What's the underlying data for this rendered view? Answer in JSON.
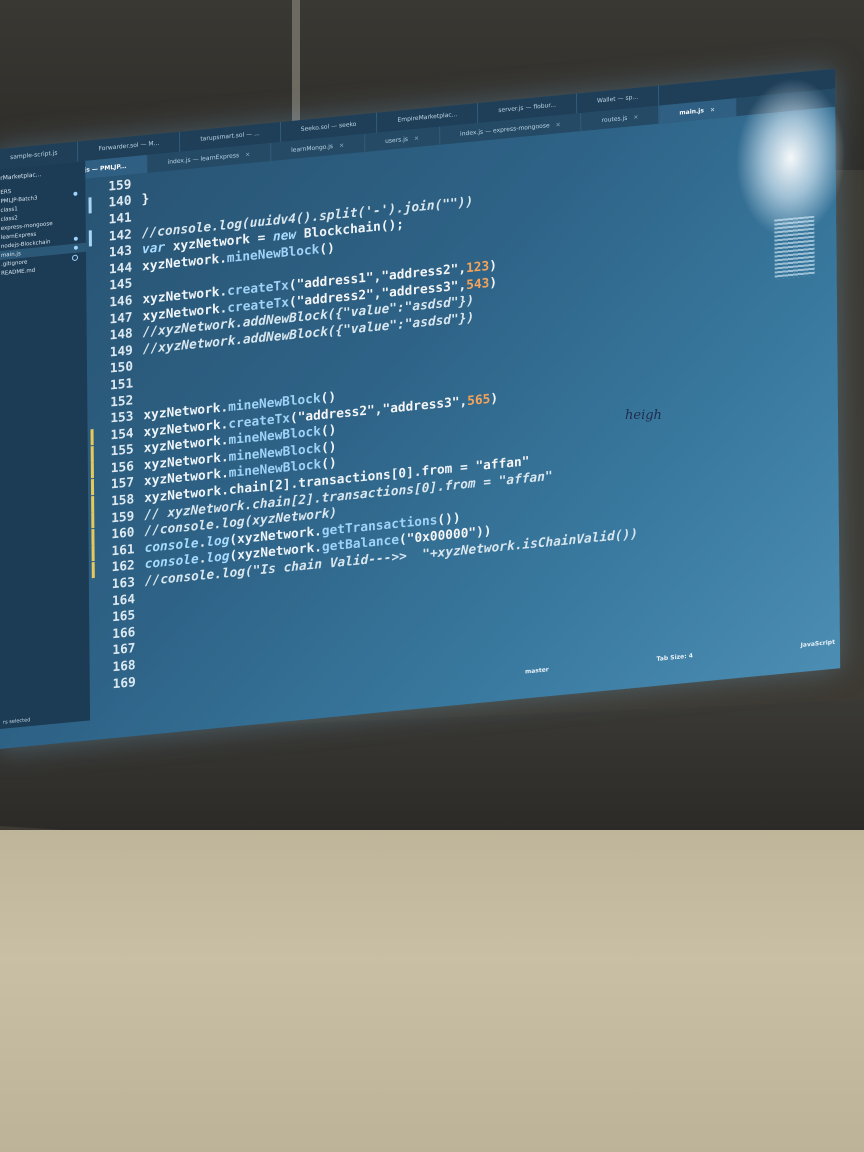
{
  "top_tabs": [
    "sample-script.js",
    "Forwarder.sol — M...",
    "tarupsmart.sol — ...",
    "Seeko.sol — seeko",
    "EmpireMarketplac...",
    "server.js — flobur...",
    "Wallet — sp..."
  ],
  "bottom_tabs": [
    {
      "label": "index.js — learnExpress",
      "active": false
    },
    {
      "label": "learnMongo.js",
      "active": false
    },
    {
      "label": "users.js",
      "active": false
    },
    {
      "label": "index.js — express-mongoose",
      "active": false
    },
    {
      "label": "routes.js",
      "active": false
    },
    {
      "label": "main.js",
      "active": true
    }
  ],
  "project_tab": "main.js — PMLJP...",
  "sidebar": {
    "title": "rMarketplac...",
    "items": [
      {
        "label": "ERS",
        "dot": ""
      },
      {
        "label": "PMLJP-Batch3",
        "dot": "filled"
      },
      {
        "label": "class1",
        "dot": ""
      },
      {
        "label": "class2",
        "dot": ""
      },
      {
        "label": "express-mongoose",
        "dot": ""
      },
      {
        "label": "learnExpress",
        "dot": ""
      },
      {
        "label": "nodejs-Blockchain",
        "dot": "filled"
      },
      {
        "label": "main.js",
        "dot": "filled",
        "active": true
      },
      {
        "label": ".gitignore",
        "dot": "hollow"
      },
      {
        "label": "README.md",
        "dot": ""
      }
    ],
    "status": "rs selected"
  },
  "code_lines": [
    {
      "n": "159",
      "m": "n",
      "html": ""
    },
    {
      "n": "140",
      "m": "b",
      "html": "<span>}</span>"
    },
    {
      "n": "141",
      "m": "n",
      "html": ""
    },
    {
      "n": "142",
      "m": "b",
      "html": "<span class='cm'>//console.log(uuidv4().split('-').join(\"\"))</span>"
    },
    {
      "n": "143",
      "m": "n",
      "html": "<span class='kw'>var</span> xyzNetwork = <span class='kw'>new</span> Blockchain();"
    },
    {
      "n": "144",
      "m": "n",
      "html": "xyzNetwork.<span class='fn'>mineNewBlock</span>()"
    },
    {
      "n": "145",
      "m": "n",
      "html": ""
    },
    {
      "n": "146",
      "m": "n",
      "html": "xyzNetwork.<span class='fn'>createTx</span>(<span class='str'>\"address1\"</span>,<span class='str'>\"address2\"</span>,<span class='num'>123</span>)"
    },
    {
      "n": "147",
      "m": "n",
      "html": "xyzNetwork.<span class='fn'>createTx</span>(<span class='str'>\"address2\"</span>,<span class='str'>\"address3\"</span>,<span class='num'>543</span>)"
    },
    {
      "n": "148",
      "m": "n",
      "html": "<span class='cm'>//xyzNetwork.addNewBlock({\"value\":\"asdsd\"})</span>"
    },
    {
      "n": "149",
      "m": "n",
      "html": "<span class='cm'>//xyzNetwork.addNewBlock({\"value\":\"asdsd\"})</span>"
    },
    {
      "n": "150",
      "m": "n",
      "html": ""
    },
    {
      "n": "151",
      "m": "n",
      "html": ""
    },
    {
      "n": "152",
      "m": "n",
      "html": ""
    },
    {
      "n": "153",
      "m": "n",
      "html": "xyzNetwork.<span class='fn'>mineNewBlock</span>()"
    },
    {
      "n": "154",
      "m": "y",
      "html": "xyzNetwork.<span class='fn'>createTx</span>(<span class='str'>\"address2\"</span>,<span class='str'>\"address3\"</span>,<span class='num'>565</span>)"
    },
    {
      "n": "155",
      "m": "y",
      "html": "xyzNetwork.<span class='fn'>mineNewBlock</span>()"
    },
    {
      "n": "156",
      "m": "y",
      "html": "xyzNetwork.<span class='fn'>mineNewBlock</span>()"
    },
    {
      "n": "157",
      "m": "y",
      "html": "xyzNetwork.<span class='fn'>mineNewBlock</span>()"
    },
    {
      "n": "158",
      "m": "y",
      "html": "xyzNetwork.chain[2].transactions[0].from = <span class='str'>\"affan\"</span>"
    },
    {
      "n": "159",
      "m": "y",
      "html": "<span class='cm'>// xyzNetwork.chain[2].transactions[0].from = \"affan\"</span>"
    },
    {
      "n": "160",
      "m": "y",
      "html": "<span class='cm'>//console.log(xyzNetwork)</span>"
    },
    {
      "n": "161",
      "m": "y",
      "html": "<span class='kw'>console</span>.<span class='kw'>log</span>(xyzNetwork.<span class='fn'>getTransactions</span>())"
    },
    {
      "n": "162",
      "m": "y",
      "html": "<span class='kw'>console</span>.<span class='kw'>log</span>(xyzNetwork.<span class='fn'>getBalance</span>(<span class='str'>\"0x00000\"</span>))"
    },
    {
      "n": "163",
      "m": "n",
      "html": "<span class='cm'>//console.log(\"Is chain Valid---&gt;&gt;  \"+xyzNetwork.isChainValid())</span>"
    },
    {
      "n": "164",
      "m": "n",
      "html": ""
    },
    {
      "n": "165",
      "m": "n",
      "html": ""
    },
    {
      "n": "166",
      "m": "n",
      "html": ""
    },
    {
      "n": "167",
      "m": "n",
      "html": ""
    },
    {
      "n": "168",
      "m": "n",
      "html": ""
    },
    {
      "n": "169",
      "m": "n",
      "html": ""
    }
  ],
  "statusbar": {
    "branch": "master",
    "tab_size": "Tab Size: 4",
    "language": "JavaScript"
  },
  "handwriting": "heigh",
  "colors": {
    "editor_bg": "#2e6387",
    "sidebar_bg": "#1c3b55",
    "number": "#f4a35a",
    "function": "#9fd3f7",
    "gutter_mark": "#e6c95a"
  }
}
